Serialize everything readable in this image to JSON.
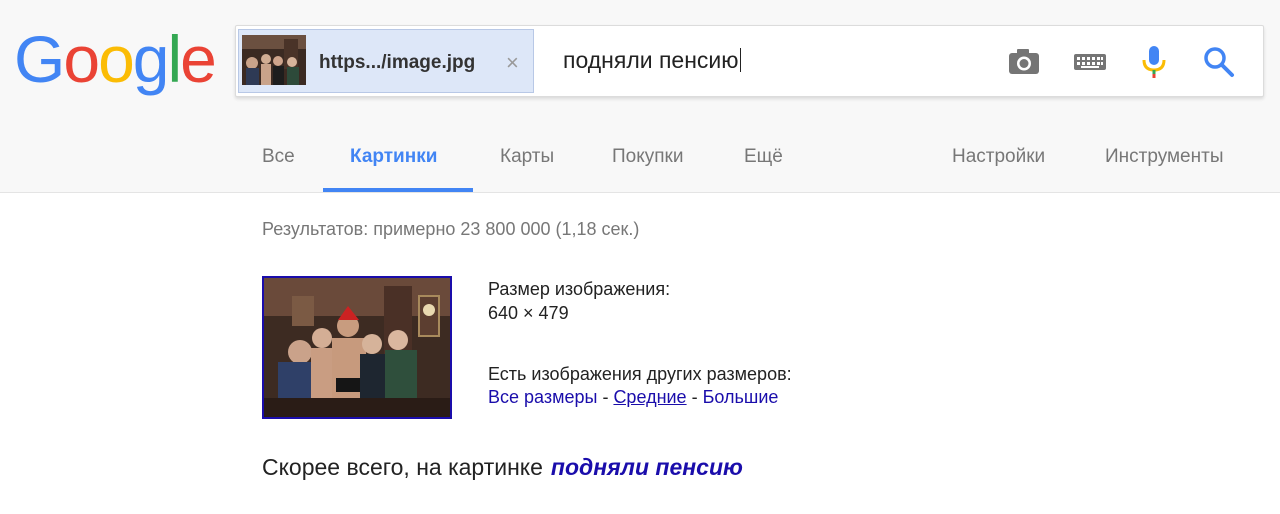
{
  "logo": {
    "letters": [
      "G",
      "o",
      "o",
      "g",
      "l",
      "e"
    ],
    "colors": [
      "#4285f4",
      "#ea4335",
      "#fbbc05",
      "#4285f4",
      "#34a853",
      "#ea4335"
    ]
  },
  "search": {
    "image_chip_label": "https.../image.jpg",
    "image_chip_close": "×",
    "query": "подняли пенсию",
    "icons": [
      "camera-icon",
      "keyboard-icon",
      "microphone-icon",
      "search-icon"
    ]
  },
  "tabs": [
    {
      "label": "Все",
      "active": false
    },
    {
      "label": "Картинки",
      "active": true
    },
    {
      "label": "Карты",
      "active": false
    },
    {
      "label": "Покупки",
      "active": false
    },
    {
      "label": "Ещё",
      "active": false
    },
    {
      "label": "Настройки",
      "active": false
    },
    {
      "label": "Инструменты",
      "active": false
    }
  ],
  "results": {
    "count_text": "Результатов: примерно 23 800 000 (1,18 сек.)",
    "size_label": "Размер изображения:",
    "size_value": "640 × 479",
    "other_sizes_label": "Есть изображения других размеров:",
    "size_links": [
      "Все размеры",
      "Средние",
      "Большие"
    ],
    "separator": " - ",
    "best_guess_label": "Скорее всего, на картинке",
    "best_guess_query": "подняли пенсию"
  },
  "colors": {
    "accent": "#4285f4",
    "link": "#1a0dab",
    "chip_bg": "#dde7f8"
  }
}
